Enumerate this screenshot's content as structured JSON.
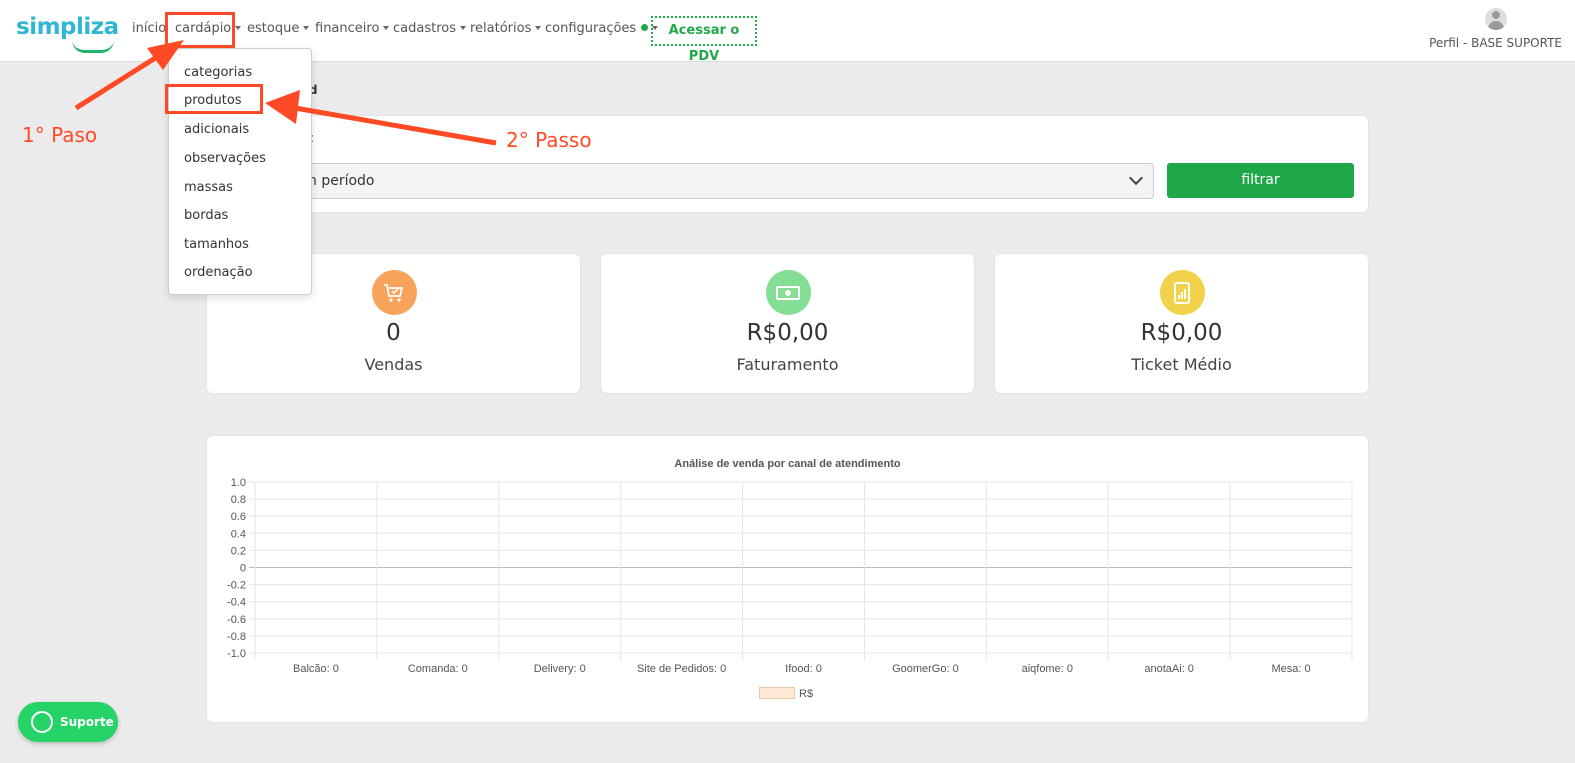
{
  "brand": {
    "logo_text": "simpliza"
  },
  "nav": {
    "inicio": "início",
    "cardapio": "cardápio",
    "estoque": "estoque",
    "financeiro": "financeiro",
    "cadastros": "cadastros",
    "relatorios": "relatórios",
    "configuracoes": "configurações",
    "pdv": "Acessar o PDV"
  },
  "profile": {
    "label": "Perfil - BASE SUPORTE"
  },
  "breadcrumb": "rd",
  "filter": {
    "label": "s:",
    "select_value": "n período",
    "button": "filtrar"
  },
  "dropdown": {
    "items": [
      "categorias",
      "produtos",
      "adicionais",
      "observações",
      "massas",
      "bordas",
      "tamanhos",
      "ordenação"
    ]
  },
  "stats": [
    {
      "value": "0",
      "label": "Vendas",
      "icon": "cart-icon",
      "color": "#f7a35c"
    },
    {
      "value": "R$0,00",
      "label": "Faturamento",
      "icon": "money-icon",
      "color": "#84de94"
    },
    {
      "value": "R$0,00",
      "label": "Ticket Médio",
      "icon": "report-icon",
      "color": "#f2d24b"
    }
  ],
  "annotations": {
    "step1": "1° Paso",
    "step2": "2° Passo"
  },
  "support": {
    "label": "Suporte"
  },
  "chart_data": {
    "type": "bar",
    "title": "Análise de venda por canal de atendimento",
    "categories": [
      "Balcão: 0",
      "Comanda: 0",
      "Delivery: 0",
      "Site de Pedidos: 0",
      "Ifood: 0",
      "GoomerGo: 0",
      "aiqfome: 0",
      "anotaAi: 0",
      "Mesa: 0"
    ],
    "series": [
      {
        "name": "R$",
        "values": [
          0,
          0,
          0,
          0,
          0,
          0,
          0,
          0,
          0
        ]
      }
    ],
    "ylim": [
      -1.0,
      1.0
    ],
    "yticks": [
      "1.0",
      "0.8",
      "0.6",
      "0.4",
      "0.2",
      "0",
      "-0.2",
      "-0.4",
      "-0.6",
      "-0.8",
      "-1.0"
    ],
    "grid": true,
    "legend_position": "bottom",
    "xlabel": "",
    "ylabel": ""
  }
}
